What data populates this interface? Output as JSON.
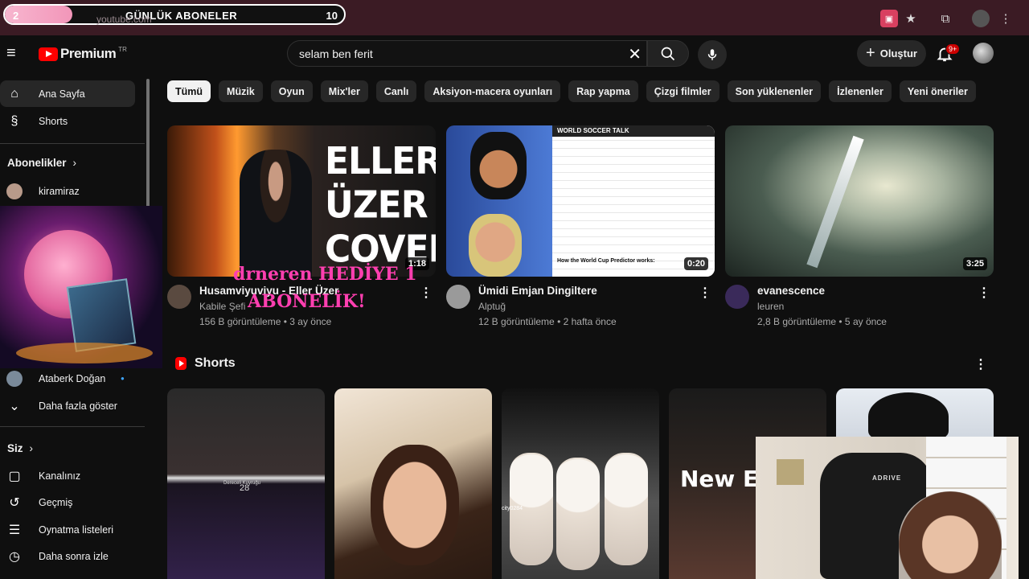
{
  "browser": {
    "overlay_left_count": "2",
    "overlay_title": "GÜNLÜK ABONELER",
    "overlay_right_count": "10",
    "overlay_progress": 0.2,
    "url": "youtube.com",
    "icons": [
      "cast-icon",
      "bookmark-star-icon",
      "extensions-icon",
      "profile-icon",
      "more-vert-icon"
    ]
  },
  "header": {
    "logo_text": "Premium",
    "logo_region": "TR",
    "search_query": "selam ben ferit",
    "create_label": "Oluştur",
    "notif_badge": "9+"
  },
  "sidebar": {
    "home": "Ana Sayfa",
    "shorts": "Shorts",
    "subscriptions_heading": "Abonelikler",
    "sub1": "kiramiraz",
    "sub_last": "Ataberk Doğan",
    "show_more": "Daha fazla göster",
    "you_heading": "Siz",
    "your_channel": "Kanalınız",
    "history": "Geçmiş",
    "playlists": "Oynatma listeleri",
    "watch_later": "Daha sonra izle"
  },
  "chips": [
    "Tümü",
    "Müzik",
    "Oyun",
    "Mix'ler",
    "Canlı",
    "Aksiyon-macera oyunları",
    "Rap yapma",
    "Çizgi filmler",
    "Son yüklenenler",
    "İzlenenler",
    "Yeni öneriler"
  ],
  "videos": [
    {
      "title": "Husamviyuviyu - Eller Üzer",
      "channel": "Kabile Şefi",
      "meta": "156 B görüntüleme • 3 ay önce",
      "duration": "1:18",
      "thumb_text": "ELLER ÜZER COVER",
      "overlay_line1": "drneren HEDİYE 1",
      "overlay_line2": "ABONELİK!"
    },
    {
      "title": "Ümidi Emjan Dingiltere",
      "channel": "Alptuğ",
      "meta": "12 B görüntüleme • 2 hafta önce",
      "duration": "0:20",
      "thumb_header": "WORLD SOCCER TALK",
      "thumb_footer": "How the World Cup Predictor works:"
    },
    {
      "title": "evanescence",
      "channel": "leuren",
      "meta": "2,8 B görüntüleme • 5 ay önce",
      "duration": "3:25"
    }
  ],
  "shorts": {
    "heading": "Shorts",
    "s1_text": "Dereceli Kuyruğu",
    "s1_num": "28",
    "s3_tag": "city0284",
    "s4_text": "New Elv"
  },
  "pip_right": {
    "chair_label": "ADRIVE"
  }
}
